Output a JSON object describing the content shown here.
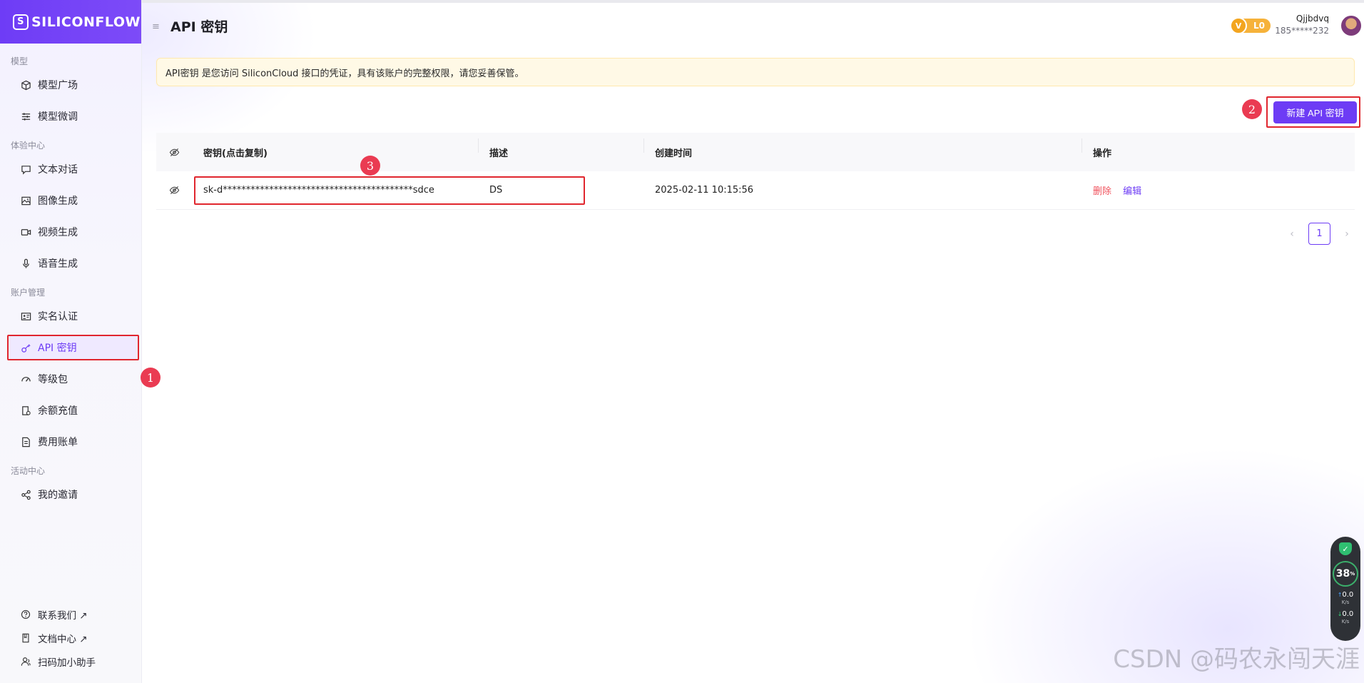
{
  "brand": {
    "name": "SILICONFLOW"
  },
  "sidebar": {
    "sections": [
      {
        "title": "模型",
        "items": [
          {
            "label": "模型广场",
            "icon": "cube-icon"
          },
          {
            "label": "模型微调",
            "icon": "sliders-icon"
          }
        ]
      },
      {
        "title": "体验中心",
        "items": [
          {
            "label": "文本对话",
            "icon": "chat-icon"
          },
          {
            "label": "图像生成",
            "icon": "image-icon"
          },
          {
            "label": "视频生成",
            "icon": "video-icon"
          },
          {
            "label": "语音生成",
            "icon": "mic-icon"
          }
        ]
      },
      {
        "title": "账户管理",
        "items": [
          {
            "label": "实名认证",
            "icon": "id-card-icon"
          },
          {
            "label": "API 密钥",
            "icon": "key-icon"
          },
          {
            "label": "等级包",
            "icon": "gauge-icon"
          },
          {
            "label": "余额充值",
            "icon": "wallet-icon"
          },
          {
            "label": "费用账单",
            "icon": "bill-icon"
          }
        ]
      },
      {
        "title": "活动中心",
        "items": [
          {
            "label": "我的邀请",
            "icon": "share-icon"
          }
        ]
      }
    ],
    "bottom_links": [
      {
        "label": "联系我们 ↗",
        "icon": "help-icon"
      },
      {
        "label": "文档中心 ↗",
        "icon": "doc-icon"
      },
      {
        "label": "扫码加小助手",
        "icon": "user-icon"
      }
    ]
  },
  "header": {
    "title": "API 密钥",
    "level_badge": "L0",
    "level_icon_letter": "V",
    "user_name": "Qjjbdvq",
    "user_phone": "185*****232"
  },
  "notice": "API密钥 是您访问 SiliconCloud 接口的凭证，具有该账户的完整权限，请您妥善保管。",
  "new_key_button": "新建 API 密钥",
  "table": {
    "columns": [
      "密钥(点击复制)",
      "描述",
      "创建时间",
      "操作"
    ],
    "rows": [
      {
        "key": "sk-d*****************************************sdce",
        "description": "DS",
        "created": "2025-02-11 10:15:56",
        "actions": [
          "删除",
          "编辑"
        ]
      }
    ]
  },
  "pagination": {
    "current": "1",
    "prev": "‹",
    "next": "›"
  },
  "markers": [
    "1",
    "2",
    "3"
  ],
  "widget": {
    "percent": "38",
    "percent_unit": "%",
    "up": "0.0",
    "up_unit": "K/s",
    "down": "0.0",
    "down_unit": "K/s"
  },
  "watermark": "CSDN @码农永闯天涯",
  "colors": {
    "accent": "#6d3cf5",
    "danger": "#f0525d",
    "highlight_box": "#e0262e",
    "marker": "#ea3b52"
  }
}
